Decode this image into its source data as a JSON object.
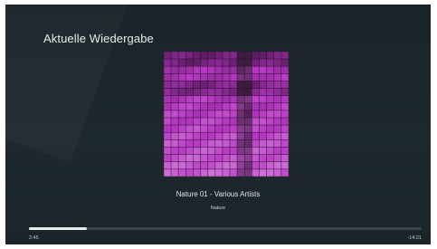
{
  "header": {
    "title": "Aktuelle Wiedergabe"
  },
  "now_playing": {
    "track_title": "Nature 01 - Various Artists",
    "album": "Nature",
    "progress_fraction": 0.147,
    "elapsed": "2:45",
    "remaining": "-14:21"
  },
  "colors": {
    "background": "#1e292d",
    "artwork_purple": "#873c8c",
    "progress_fill": "#e8ecee",
    "progress_track": "#3a4448"
  }
}
